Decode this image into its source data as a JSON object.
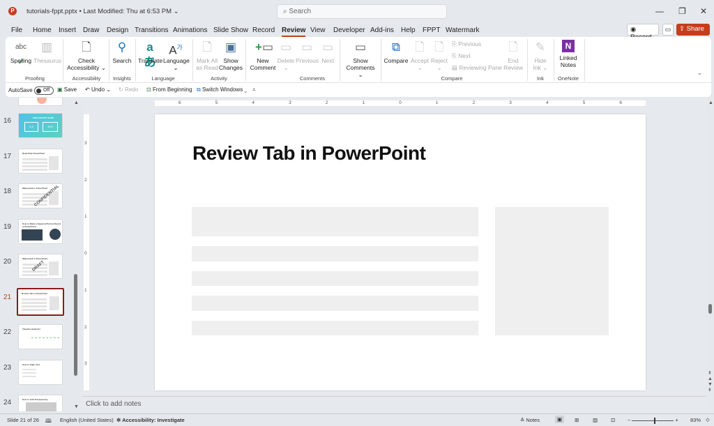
{
  "titlebar": {
    "app_icon": "P",
    "doc": "tutorials-fppt.pptx  •  Last Modified: Thu at 6:53 PM ⌄",
    "search_placeholder": "Search",
    "minimize": "—",
    "restore": "❐",
    "close": "✕"
  },
  "tabs": [
    "File",
    "Home",
    "Insert",
    "Draw",
    "Design",
    "Transitions",
    "Animations",
    "Slide Show",
    "Record",
    "Review",
    "View",
    "Developer",
    "Add-ins",
    "Help",
    "FPPT",
    "Watermark"
  ],
  "active_tab": "Review",
  "header_buttons": {
    "record": "Record",
    "share": "Share ⌄",
    "comments_icon": "comment-icon"
  },
  "ribbon": {
    "spelling": "Spelling",
    "thesaurus": "Thesaurus",
    "proofing": "Proofing",
    "check_accessibility_1": "Check",
    "check_accessibility_2": "Accessibility ⌄",
    "accessibility": "Accessibility",
    "search": "Search",
    "insights": "Insights",
    "translate": "Translate",
    "language_btn": "Language",
    "language": "Language",
    "mark_all_1": "Mark All",
    "mark_all_2": "as Read",
    "show_changes_1": "Show",
    "show_changes_2": "Changes",
    "activity": "Activity",
    "new_comment_1": "New",
    "new_comment_2": "Comment",
    "delete": "Delete",
    "previous": "Previous",
    "next": "Next",
    "show_comments_1": "Show",
    "show_comments_2": "Comments ⌄",
    "comments": "Comments",
    "compare_btn": "Compare",
    "accept": "Accept",
    "reject": "Reject",
    "prev_small": "Previous",
    "next_small": "Next",
    "reviewing_pane": "Reviewing Pane",
    "end_review_1": "End",
    "end_review_2": "Review",
    "compare": "Compare",
    "hide_ink_1": "Hide",
    "hide_ink_2": "Ink ⌄",
    "ink": "Ink",
    "linked_notes_1": "Linked",
    "linked_notes_2": "Notes",
    "onenote": "OneNote"
  },
  "qat": {
    "autosave": "AutoSave",
    "autosave_state": "Off",
    "save": "Save",
    "undo": "Undo",
    "redo": "Redo",
    "from_beginning": "From Beginning",
    "switch_windows": "Switch Windows ⌄"
  },
  "thumbnails": [
    {
      "num": "16",
      "title": "SIZE FOR PPT SLIDE",
      "a": "4:3",
      "b": "16:9"
    },
    {
      "num": "17",
      "title": "Read Only PowerPoint"
    },
    {
      "num": "18",
      "title": "Watermark in PowerPoint",
      "stamp": "CONFIDENTIAL"
    },
    {
      "num": "19",
      "title": "How to Make a Squared Picture Round in PowerPoint"
    },
    {
      "num": "20",
      "title": "Watermark in PowerPoint",
      "stamp": "DRAFT"
    },
    {
      "num": "21",
      "title": "Review Tab in PowerPoint"
    },
    {
      "num": "22",
      "title": "Timeline SmartArt"
    },
    {
      "num": "23",
      "title": "How to Align Text"
    },
    {
      "num": "24",
      "title": "How to Add Transparency"
    }
  ],
  "ruler_h": [
    "6",
    "5",
    "4",
    "3",
    "2",
    "1",
    "0",
    "1",
    "2",
    "3",
    "4",
    "5",
    "6"
  ],
  "ruler_v": [
    "3",
    "2",
    "1",
    "0",
    "1",
    "2",
    "3"
  ],
  "slide": {
    "title": "Review Tab in PowerPoint"
  },
  "notes_placeholder": "Click to add notes",
  "status": {
    "slide": "Slide 21 of 26",
    "language": "English (United States)",
    "accessibility": "Accessibility: Investigate",
    "notes": "Notes",
    "zoom": "83%",
    "zoom_level": 83
  },
  "colors": {
    "accent": "#c43e1c",
    "selected_thumb": "#8b1a1a",
    "placeholder": "#efefef"
  }
}
